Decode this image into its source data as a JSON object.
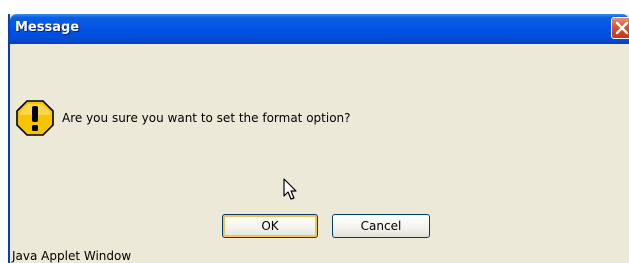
{
  "window": {
    "title": "Message"
  },
  "dialog": {
    "message": "Are you sure you want to set the format option?",
    "icon": "warning-icon"
  },
  "buttons": {
    "ok_label": "OK",
    "cancel_label": "Cancel"
  },
  "status": {
    "text": "Java Applet Window"
  },
  "colors": {
    "title_bar": "#0055e5",
    "dialog_bg": "#ece9d8",
    "warning_yellow": "#f7c500",
    "close_red": "#d7512c",
    "default_button_highlight": "#f5c453"
  }
}
